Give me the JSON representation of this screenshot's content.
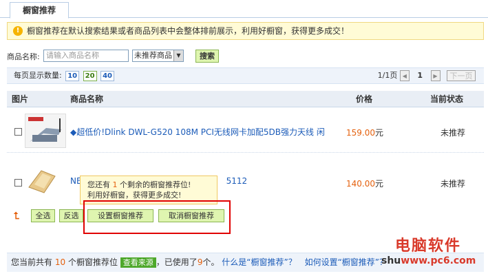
{
  "tab": "橱窗推荐",
  "tip": "橱窗推荐在默认搜索结果或者商品列表中会整体排前展示，利用好橱窗，获得更多成交！",
  "search": {
    "label": "商品名称:",
    "placeholder": "请输入商品名称",
    "select_value": "未推荐商品",
    "button": "搜索"
  },
  "per_page": {
    "label": "每页显示数量:",
    "options": [
      "10",
      "20",
      "40"
    ],
    "selected": "20"
  },
  "pager": {
    "info": "1/1页",
    "current": "1",
    "next": "下一页"
  },
  "table": {
    "headers": {
      "image": "图片",
      "name": "商品名称",
      "price": "价格",
      "status": "当前状态"
    },
    "rows": [
      {
        "name": "◆超低价!Dlink DWL-G520 108M PCI无线网卡加配5DB强力天线 闲",
        "price": "159.00",
        "price_unit": "元",
        "status": "未推荐"
      },
      {
        "name_prefix": "NE",
        "name_suffix": "5112",
        "price": "140.00",
        "price_unit": "元",
        "status": "未推荐"
      }
    ]
  },
  "tooltip": {
    "line1_pre": "您还有",
    "count": "1",
    "line1_post": "个剩余的橱窗推荐位!",
    "line2": "利用好橱窗，获得更多成交!"
  },
  "actions": {
    "select_all": "全选",
    "invert": "反选",
    "set": "设置橱窗推荐",
    "cancel": "取消橱窗推荐"
  },
  "footer": {
    "pre": "您当前共有",
    "total": "10",
    "mid": "个橱窗推荐位",
    "source_btn": "查看来源",
    "used_pre": "，已使用了",
    "used": "9",
    "used_post": "个。",
    "link1": "什么是“橱窗推荐”？",
    "link2": "如何设置“橱窗推荐”？"
  },
  "watermark": {
    "line1": "电脑软件",
    "line2_a": "shu",
    "line2_b": "www.pc6.com"
  },
  "colors": {
    "price": "#e4600d",
    "link": "#1b5bb8",
    "highlight_box": "#e00000"
  }
}
